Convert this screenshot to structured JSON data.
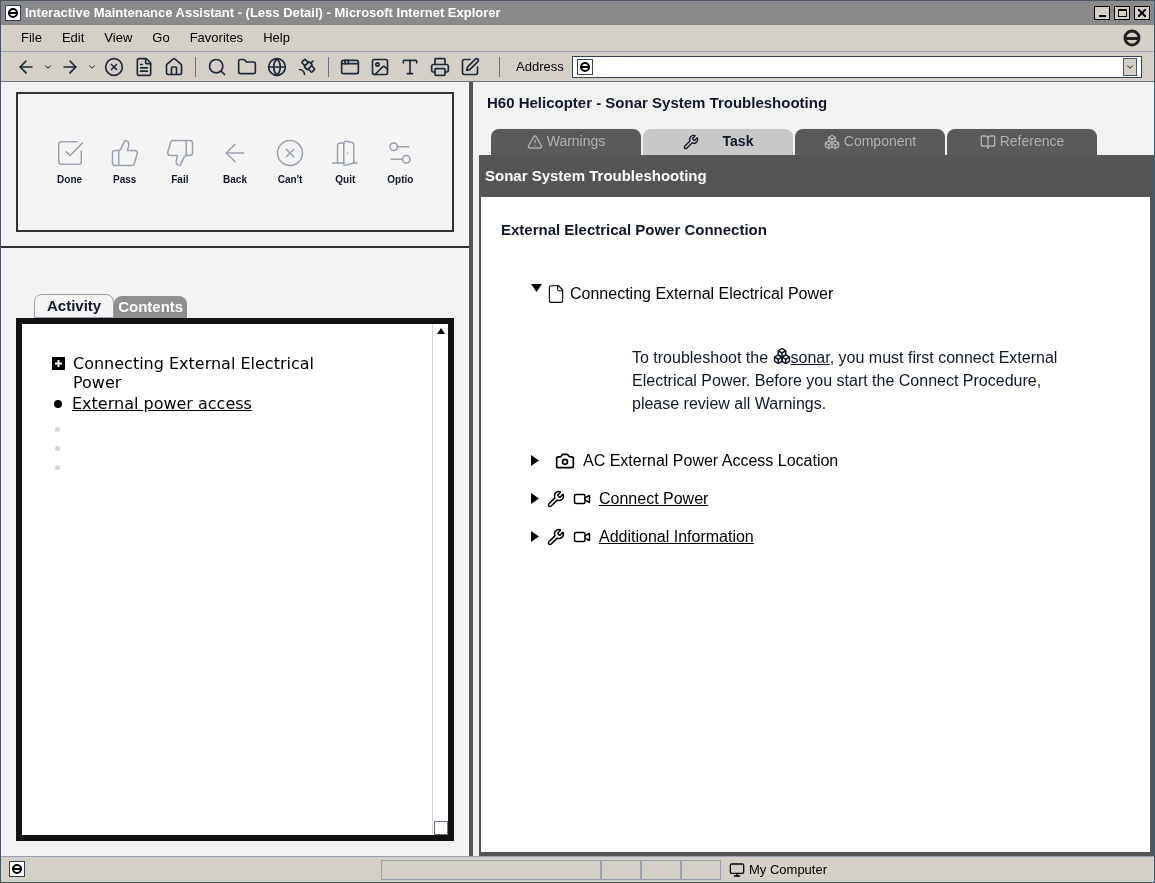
{
  "window": {
    "title": "Interactive Maintenance Assistant - (Less Detail) - Microsoft Internet Explorer"
  },
  "menu": [
    "File",
    "Edit",
    "View",
    "Go",
    "Favorites",
    "Help"
  ],
  "address": {
    "label": "Address"
  },
  "action_buttons": [
    {
      "label": "Done",
      "kind": "done"
    },
    {
      "label": "Pass",
      "kind": "pass"
    },
    {
      "label": "Fail",
      "kind": "fail"
    },
    {
      "label": "Back",
      "kind": "back"
    },
    {
      "label": "Can't",
      "kind": "cant"
    },
    {
      "label": "Quit",
      "kind": "quit"
    },
    {
      "label": "Optio",
      "kind": "option"
    }
  ],
  "left_tabs": [
    {
      "label": "Activity",
      "selected": true
    },
    {
      "label": "Contents",
      "selected": false
    }
  ],
  "tree": [
    {
      "label": "Connecting External Electrical Power",
      "kind": "section"
    },
    {
      "label": "External power access",
      "kind": "link"
    }
  ],
  "heading": "H60 Helicopter - Sonar System Troubleshooting",
  "right_tabs": [
    {
      "label": "Warnings",
      "selected": false,
      "kind": "warnings"
    },
    {
      "label": "Task",
      "selected": true,
      "kind": "task"
    },
    {
      "label": "Component",
      "selected": false,
      "kind": "component"
    },
    {
      "label": "Reference",
      "selected": false,
      "kind": "reference"
    }
  ],
  "band_title": "Sonar System Troubleshooting",
  "section_title": "External Electrical Power Connection",
  "procedure": {
    "title": "Connecting External Electrical Power",
    "expanded": true,
    "text_before": "To troubleshoot the",
    "link": "sonar",
    "text_after": ", you must first connect External Electrical Power. Before you start the Connect Procedure, please review all Warnings."
  },
  "steps": [
    {
      "label": "AC External Power Access Location",
      "kind": "photo",
      "expanded": false
    },
    {
      "label": "Connect Power",
      "kind": "task",
      "expanded": false
    },
    {
      "label": "Additional Information",
      "kind": "task",
      "expanded": false
    }
  ],
  "status_bar": {
    "zone": "My Computer"
  }
}
